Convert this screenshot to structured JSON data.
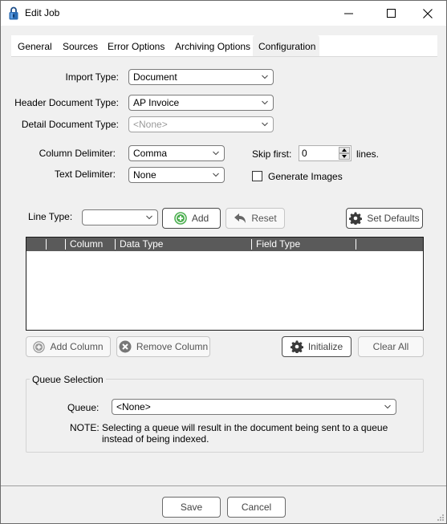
{
  "window": {
    "title": "Edit Job",
    "icon": "padlock-icon",
    "controls": [
      "minimize",
      "maximize",
      "close"
    ]
  },
  "tabs": [
    {
      "label": "General",
      "active": false
    },
    {
      "label": "Sources",
      "active": false
    },
    {
      "label": "Error Options",
      "active": false
    },
    {
      "label": "Archiving Options",
      "active": false
    },
    {
      "label": "Configuration",
      "active": true
    }
  ],
  "form": {
    "import_type": {
      "label": "Import Type:",
      "value": "Document"
    },
    "header_doc_type": {
      "label": "Header Document Type:",
      "value": "AP Invoice"
    },
    "detail_doc_type": {
      "label": "Detail Document Type:",
      "value": "<None>",
      "disabled": true
    },
    "column_delimiter": {
      "label": "Column Delimiter:",
      "value": "Comma"
    },
    "text_delimiter": {
      "label": "Text Delimiter:",
      "value": "None"
    },
    "skip_first": {
      "label": "Skip first:",
      "value": "0",
      "suffix": "lines."
    },
    "generate_images": {
      "label": "Generate Images",
      "checked": false
    }
  },
  "line_type": {
    "label": "Line Type:",
    "value": "",
    "add_label": "Add",
    "reset_label": "Reset",
    "set_defaults_label": "Set Defaults"
  },
  "grid": {
    "columns": [
      "",
      "",
      "Column",
      "Data Type",
      "Field Type",
      ""
    ],
    "rows": []
  },
  "grid_actions": {
    "add_column_label": "Add Column",
    "remove_column_label": "Remove Column",
    "initialize_label": "Initialize",
    "clear_all_label": "Clear All"
  },
  "queue": {
    "group_title": "Queue Selection",
    "label": "Queue:",
    "value": "<None>",
    "note_label": "NOTE:",
    "note_line1": "Selecting a queue will result in the document being sent to a queue",
    "note_line2": "instead of being indexed."
  },
  "footer": {
    "save_label": "Save",
    "cancel_label": "Cancel"
  },
  "colors": {
    "grid_header_bg": "#5a5a5a",
    "add_icon_green": "#4caf50",
    "window_bg": "#f0f0f0"
  }
}
